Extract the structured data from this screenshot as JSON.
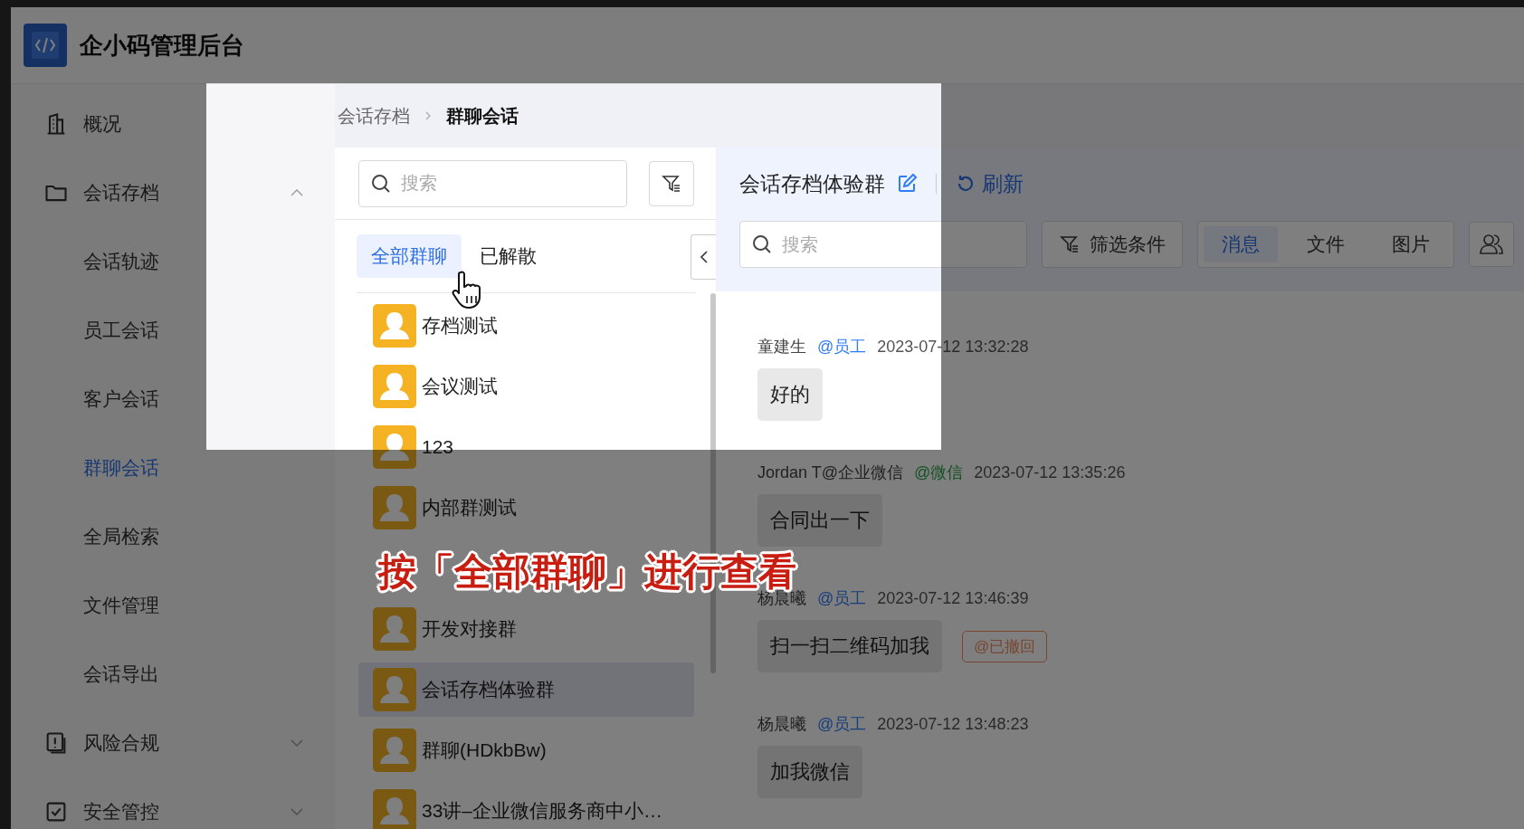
{
  "app": {
    "title": "企小码管理后台"
  },
  "sidebar": {
    "items": [
      {
        "label": "概况"
      },
      {
        "label": "会话存档",
        "expanded": true,
        "children": [
          {
            "label": "会话轨迹",
            "selected": false
          },
          {
            "label": "员工会话",
            "selected": false
          },
          {
            "label": "客户会话",
            "selected": false
          },
          {
            "label": "群聊会话",
            "selected": true
          },
          {
            "label": "全局检索",
            "selected": false
          },
          {
            "label": "文件管理",
            "selected": false
          },
          {
            "label": "会话导出",
            "selected": false
          }
        ]
      },
      {
        "label": "风险合规",
        "expanded": false
      },
      {
        "label": "安全管控",
        "expanded": false
      }
    ]
  },
  "breadcrumb": [
    "会话存档",
    "群聊会话"
  ],
  "group_list": {
    "search": {
      "placeholder": "搜索"
    },
    "tabs": [
      {
        "label": "全部群聊",
        "selected": true
      },
      {
        "label": "已解散",
        "selected": false
      }
    ],
    "items": [
      {
        "name": "存档测试",
        "selected": false
      },
      {
        "name": "会议测试",
        "selected": false
      },
      {
        "name": "123",
        "selected": false
      },
      {
        "name": "内部群测试",
        "selected": false
      },
      {
        "kind": "covered"
      },
      {
        "name": "开发对接群",
        "selected": false
      },
      {
        "name": "会话存档体验群",
        "selected": true
      },
      {
        "name": "群聊(HDkbBw)",
        "selected": false
      },
      {
        "name": "33讲–企业微信服务商中小…",
        "selected": false
      }
    ]
  },
  "chat": {
    "title": "会话存档体验群",
    "refresh": "刷新",
    "search": {
      "placeholder": "搜索"
    },
    "filter": "筛选条件",
    "tabs": [
      {
        "label": "消息",
        "selected": true
      },
      {
        "label": "文件",
        "selected": false
      },
      {
        "label": "图片",
        "selected": false
      }
    ],
    "messages": [
      {
        "sender": "童建生",
        "tag": "@员工",
        "kind": "employee",
        "time": "2023-07-12 13:32:28",
        "text": "好的"
      },
      {
        "sender": "Jordan T@企业微信",
        "tag": "@微信",
        "kind": "wechat",
        "time": "2023-07-12 13:35:26",
        "text": "合同出一下"
      },
      {
        "sender": "杨晨曦",
        "tag": "@员工",
        "kind": "employee",
        "time": "2023-07-12 13:46:39",
        "text": "扫一扫二维码加我",
        "badge": "@已撤回"
      },
      {
        "sender": "杨晨曦",
        "tag": "@员工",
        "kind": "employee",
        "time": "2023-07-12 13:48:23",
        "text": "加我微信"
      }
    ]
  },
  "caption": "按「全部群聊」进行查看"
}
